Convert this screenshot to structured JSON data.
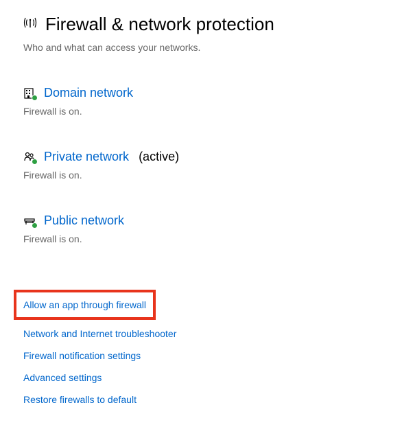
{
  "header": {
    "title": "Firewall & network protection",
    "subtitle": "Who and what can access your networks."
  },
  "networks": [
    {
      "label": "Domain network",
      "active_label": "",
      "status": "Firewall is on."
    },
    {
      "label": "Private network",
      "active_label": "(active)",
      "status": "Firewall is on."
    },
    {
      "label": "Public network",
      "active_label": "",
      "status": "Firewall is on."
    }
  ],
  "links": {
    "allow_app": "Allow an app through firewall",
    "troubleshooter": "Network and Internet troubleshooter",
    "notification_settings": "Firewall notification settings",
    "advanced_settings": "Advanced settings",
    "restore_default": "Restore firewalls to default"
  }
}
